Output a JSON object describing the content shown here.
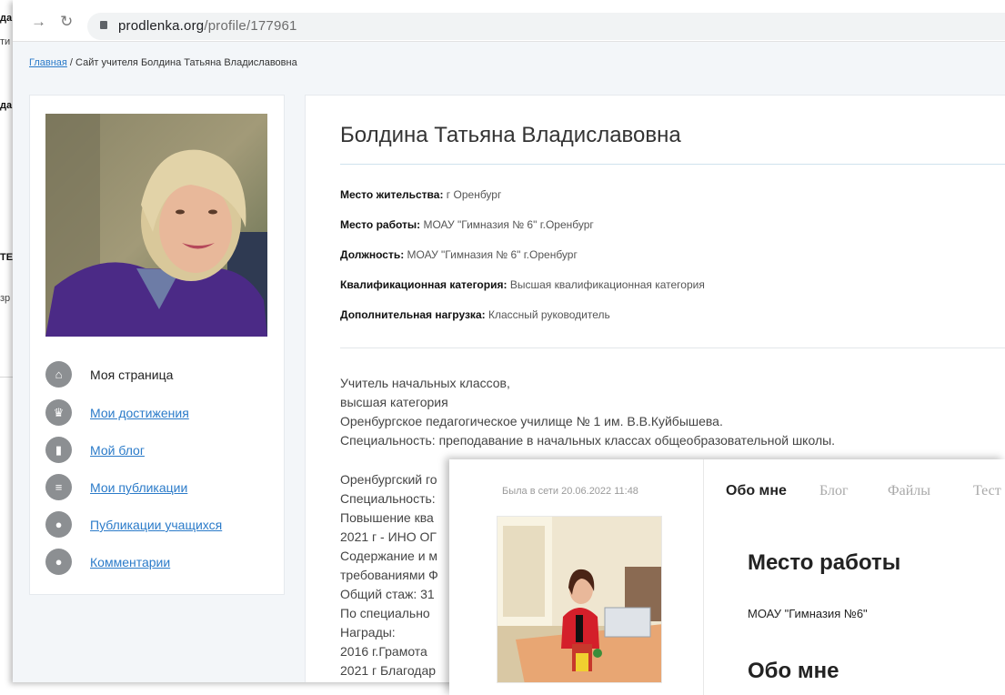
{
  "background_window": {
    "fragments": [
      "да",
      "ти",
      "да",
      "ТЕ",
      "зр"
    ]
  },
  "browser": {
    "url_host": "prodlenka.org",
    "url_path": "/profile/177961",
    "back_icon": "arrow-right-icon",
    "reload_icon": "reload-icon"
  },
  "breadcrumb": {
    "home": "Главная",
    "separator": " / ",
    "current": "Сайт учителя Болдина Татьяна Владиславовна"
  },
  "sidebar": {
    "items": [
      {
        "label": "Моя страница",
        "icon": "home-icon",
        "current": true
      },
      {
        "label": "Мои достижения",
        "icon": "trophy-icon"
      },
      {
        "label": "Мой блог",
        "icon": "blog-icon"
      },
      {
        "label": "Мои публикации",
        "icon": "document-icon"
      },
      {
        "label": "Публикации учащихся",
        "icon": "user-icon"
      },
      {
        "label": "Комментарии",
        "icon": "comment-icon"
      }
    ]
  },
  "profile": {
    "name": "Болдина Татьяна Владиславовна",
    "residence_label": "Место жительства:",
    "residence": "г Оренбург",
    "work_label": "Место работы:",
    "work": "МОАУ \"Гимназия № 6\" г.Оренбург",
    "position_label": "Должность:",
    "position": "МОАУ \"Гимназия № 6\" г.Оренбург",
    "category_label": "Квалификационная категория:",
    "category": "Высшая квалификационная категория",
    "extra_label": "Дополнительная нагрузка:",
    "extra": "Классный руководитель"
  },
  "bio": {
    "lines": [
      "Учитель начальных классов,",
      "высшая категория",
      "Оренбургское педагогическое училище № 1 им. В.В.Куйбышева.",
      "Специальность: преподавание в начальных классах общеобразовательной школы."
    ],
    "lines2": [
      "Оренбургский го",
      "Специальность:",
      "Повышение ква",
      "2021 г - ИНО ОГ",
      "Содержание и м",
      "требованиями Ф",
      "Общий стаж: 31",
      "По специально",
      "Награды:",
      "2016 г.Грамота",
      "2021 г Благодар"
    ]
  },
  "overlay": {
    "last_seen": "Была в сети 20.06.2022 11:48",
    "tabs": [
      "Обо мне",
      "Блог",
      "Файлы",
      "Тест"
    ],
    "work_heading": "Место работы",
    "work_value": "МОАУ \"Гимназия №6\"",
    "about_heading": "Обо мне"
  }
}
